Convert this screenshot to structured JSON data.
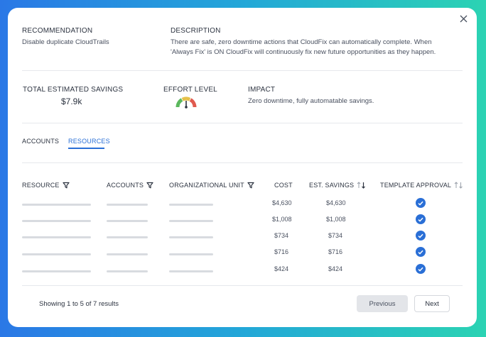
{
  "recommendation": {
    "label": "RECOMMENDATION",
    "value": "Disable duplicate CloudTrails"
  },
  "description": {
    "label": "DESCRIPTION",
    "line1": "There are safe, zero downtime actions that CloudFix can automatically complete. When",
    "line2": "'Always Fix' is ON CloudFix will continuously fix new future opportunities as they happen."
  },
  "savings": {
    "label": "TOTAL ESTIMATED SAVINGS",
    "value": "$7.9k"
  },
  "effort": {
    "label": "EFFORT LEVEL",
    "level": "low"
  },
  "impact": {
    "label": "IMPACT",
    "value": "Zero downtime, fully automatable savings."
  },
  "tabs": [
    {
      "label": "ACCOUNTS",
      "active": false
    },
    {
      "label": "RESOURCES",
      "active": true
    }
  ],
  "table": {
    "headers": {
      "resource": "RESOURCE",
      "accounts": "ACCOUNTS",
      "org_unit": "ORGANIZATIONAL UNIT",
      "cost": "COST",
      "est_savings": "EST. SAVINGS",
      "template_approval": "TEMPLATE APPROVAL"
    },
    "rows": [
      {
        "cost": "$4,630",
        "savings": "$4,630",
        "approved": true
      },
      {
        "cost": "$1,008",
        "savings": "$1,008",
        "approved": true
      },
      {
        "cost": "$734",
        "savings": "$734",
        "approved": true
      },
      {
        "cost": "$716",
        "savings": "$716",
        "approved": true
      },
      {
        "cost": "$424",
        "savings": "$424",
        "approved": true
      }
    ]
  },
  "footer": {
    "showing": "Showing 1 to 5 of 7 results",
    "previous": "Previous",
    "next": "Next"
  },
  "colors": {
    "accent": "#2a6fd6",
    "gauge_green": "#5bb85d",
    "gauge_yellow": "#e6c14a",
    "gauge_red": "#e05a4f"
  },
  "icons": {
    "close": "close-icon",
    "filter": "filter-icon",
    "sort": "sort-icon",
    "check": "check-circle-icon"
  }
}
